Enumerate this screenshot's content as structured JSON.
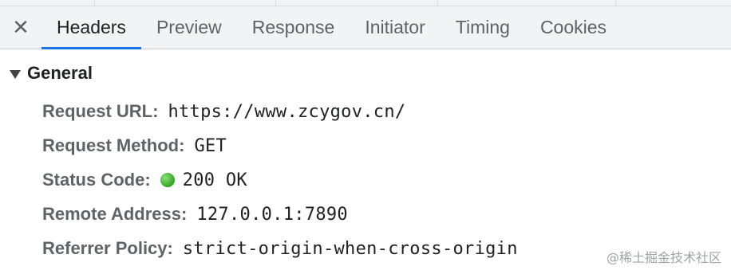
{
  "tabs": {
    "close_glyph": "✕",
    "items": [
      {
        "label": "Headers"
      },
      {
        "label": "Preview"
      },
      {
        "label": "Response"
      },
      {
        "label": "Initiator"
      },
      {
        "label": "Timing"
      },
      {
        "label": "Cookies"
      }
    ],
    "active_index": 0,
    "accent_color": "#1a73e8"
  },
  "general": {
    "title": "General",
    "rows": [
      {
        "key": "Request URL:",
        "value": "https://www.zcygov.cn/"
      },
      {
        "key": "Request Method:",
        "value": "GET"
      },
      {
        "key": "Status Code:",
        "value": "200 OK",
        "status_color": "#2fa51d"
      },
      {
        "key": "Remote Address:",
        "value": "127.0.0.1:7890"
      },
      {
        "key": "Referrer Policy:",
        "value": "strict-origin-when-cross-origin"
      }
    ]
  },
  "watermark": "@稀土掘金技术社区"
}
